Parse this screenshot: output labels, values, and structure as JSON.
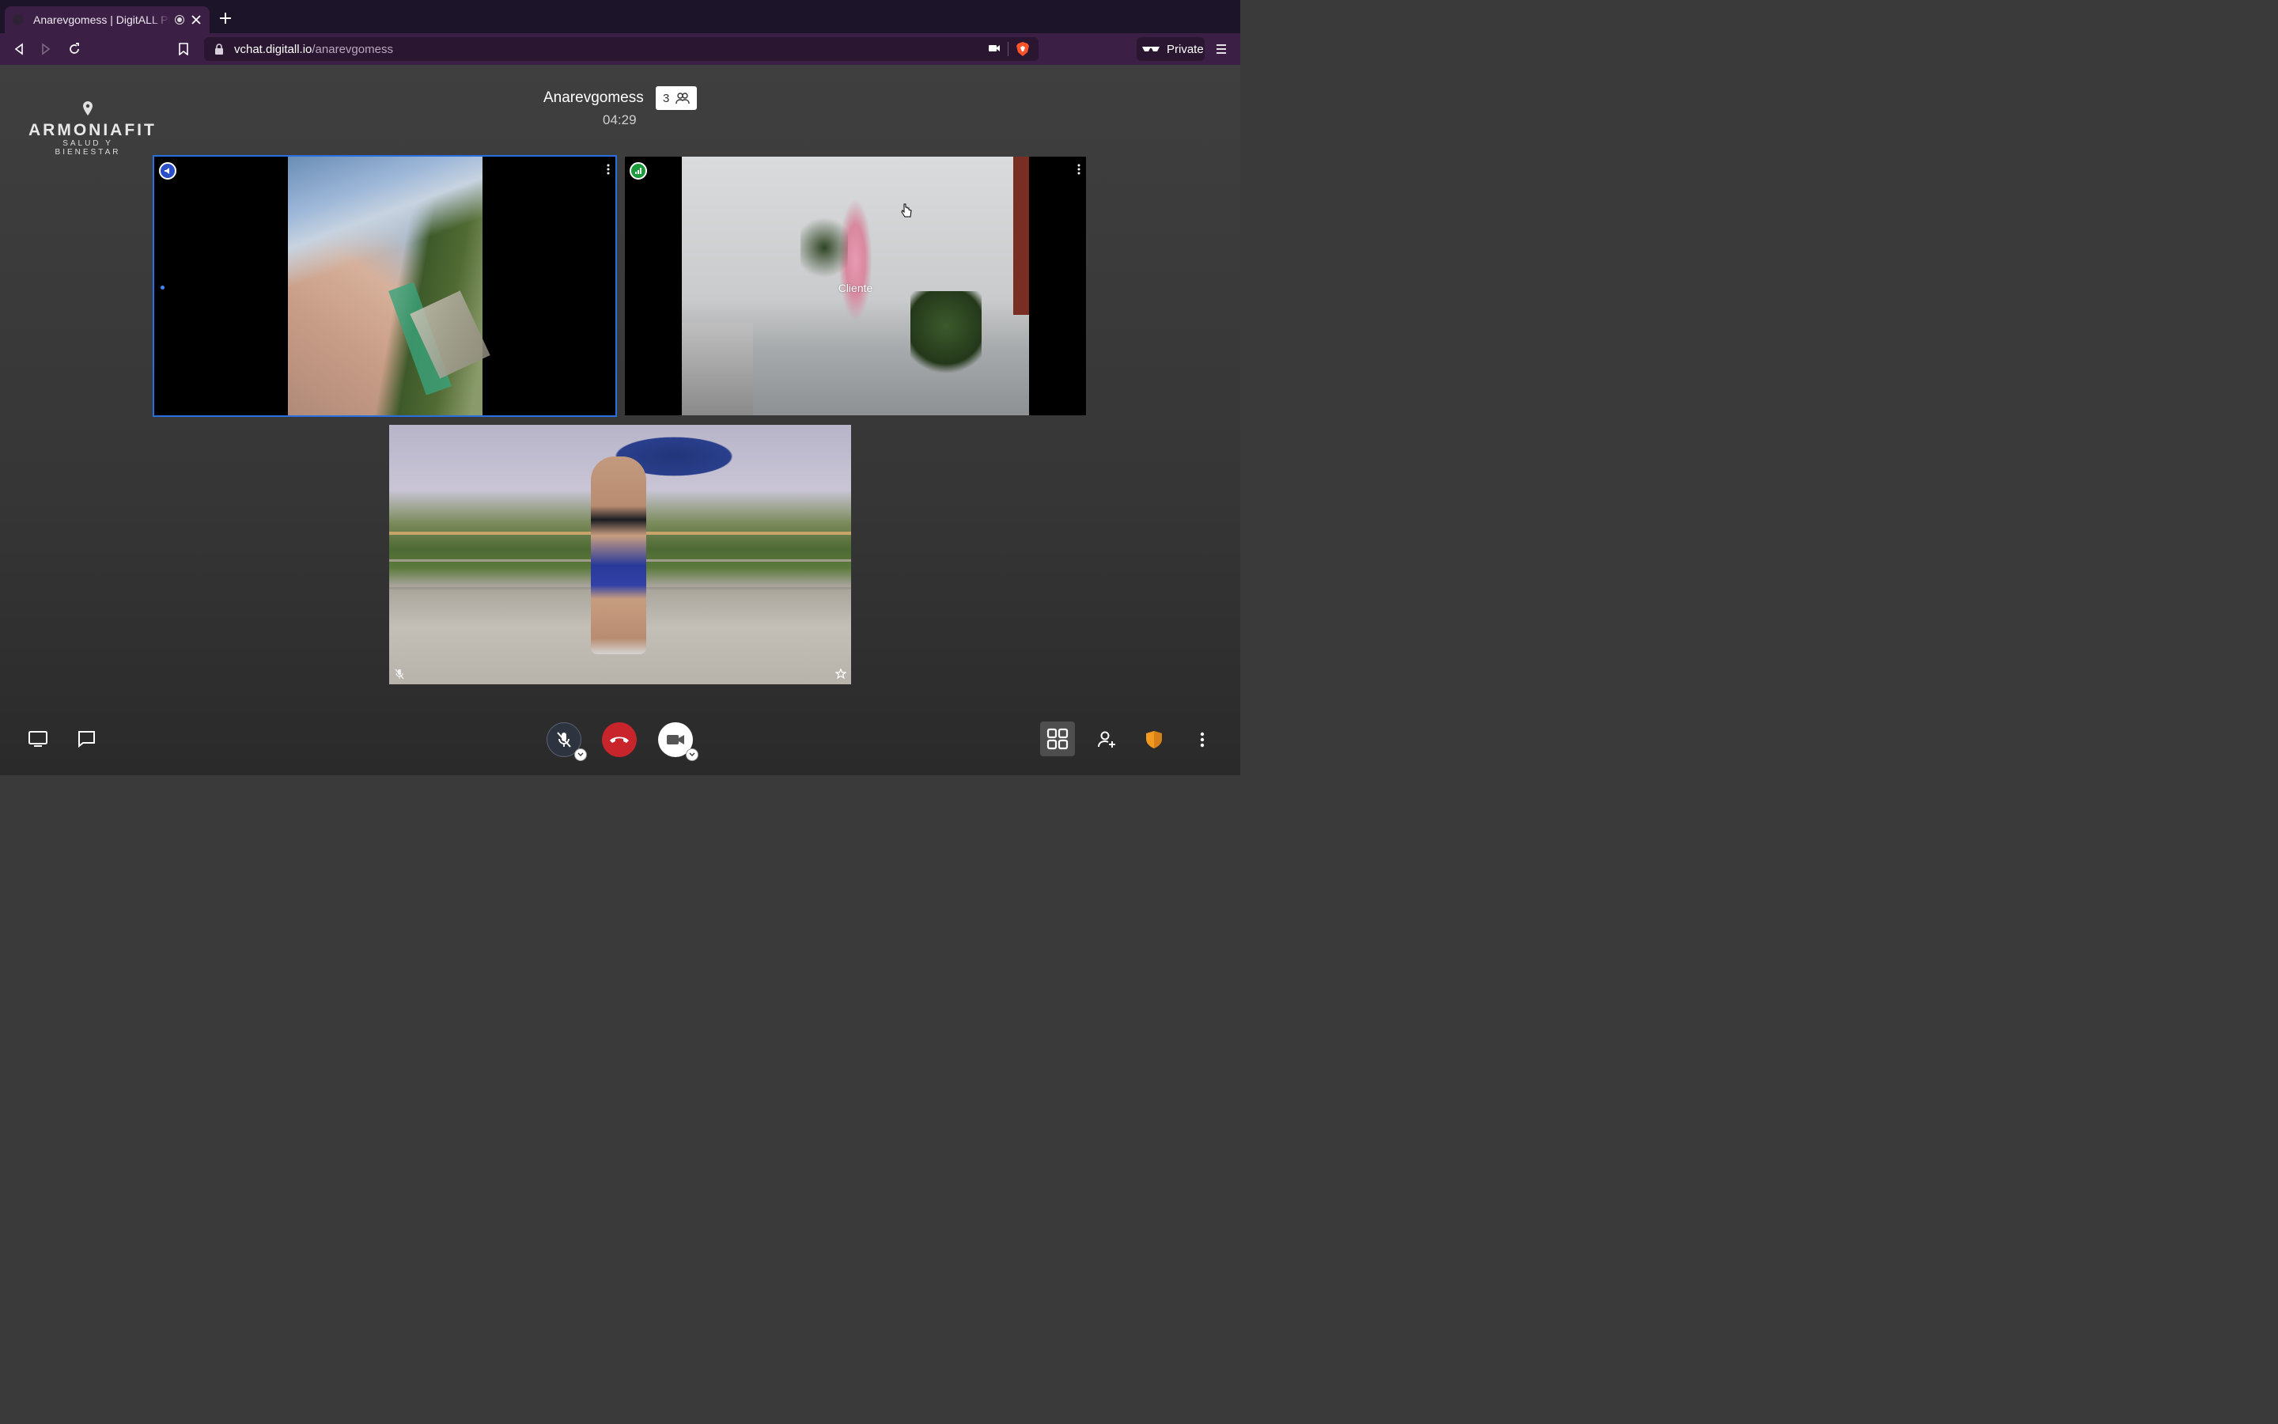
{
  "browser": {
    "tab_title": "Anarevgomess | DigitALL PRO",
    "url_domain": "vchat.digitall.io",
    "url_path": "/anarevgomess",
    "private_label": "Private"
  },
  "logo": {
    "brand": "ARMONIAFIT",
    "tagline": "SALUD Y BIENESTAR"
  },
  "meeting": {
    "room_name": "Anarevgomess",
    "participant_count": "3",
    "timer": "04:29"
  },
  "tiles": [
    {
      "name": "",
      "status_icon": "speaker-icon",
      "active": true
    },
    {
      "name": "Cliente",
      "status_icon": "signal-icon",
      "active": false
    },
    {
      "name": "",
      "status_icon": "mic-off-icon",
      "active": false
    }
  ],
  "toolbar": {
    "left": [
      "screen-share-icon",
      "chat-icon"
    ],
    "center": [
      "mic-off-icon",
      "hangup-icon",
      "camera-icon"
    ],
    "right": [
      "grid-view-icon",
      "invite-user-icon",
      "security-shield-icon",
      "more-options-icon"
    ]
  },
  "colors": {
    "browser_bg": "#1c1428",
    "toolbar_bg": "#3b1f45",
    "active_tile_border": "#2a6fe0",
    "hangup": "#c8242b",
    "signal_green": "#1c9b3a"
  }
}
